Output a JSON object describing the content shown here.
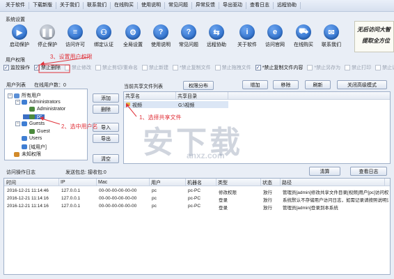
{
  "menubar": {
    "items": [
      "关于软件",
      "下载新版",
      "关于我们",
      "联系我们",
      "在线购买",
      "使用说明",
      "常见问题",
      "异常反馈",
      "导出驱动",
      "查看日志",
      "远程协助"
    ]
  },
  "system_settings": {
    "label": "系统设置"
  },
  "toolbar": {
    "buttons": [
      {
        "label": "启动保护",
        "icon": "play-icon",
        "color": "#1a5fc2"
      },
      {
        "label": "停止保护",
        "icon": "pause-icon",
        "color": "#9aa3b1"
      },
      {
        "label": "访问许可",
        "icon": "user-list-icon",
        "color": "#1a5fc2"
      },
      {
        "label": "绑定认证",
        "icon": "link-icon",
        "color": "#1a5fc2"
      },
      {
        "label": "全局设置",
        "icon": "gear-icon",
        "color": "#1a5fc2"
      },
      {
        "label": "使用说明",
        "icon": "help-icon",
        "color": "#1a5fc2"
      },
      {
        "label": "常见问题",
        "icon": "help-icon",
        "color": "#1a5fc2"
      },
      {
        "label": "远程协助",
        "icon": "remote-icon",
        "color": "#1a5fc2"
      },
      {
        "label": "关于软件",
        "icon": "info-icon",
        "color": "#1a5fc2"
      },
      {
        "label": "访问官网",
        "icon": "browser-icon",
        "color": "#1a5fc2"
      },
      {
        "label": "在线购买",
        "icon": "cart-icon",
        "color": "#1a5fc2"
      },
      {
        "label": "联系我们",
        "icon": "contact-icon",
        "color": "#1a5fc2"
      }
    ]
  },
  "logo": {
    "line1": "无后访问大智",
    "line2": "提取全方位"
  },
  "user_permissions": {
    "label": "用户权限",
    "items": [
      {
        "label": "监控操作",
        "checked": true,
        "enabled": true
      },
      {
        "label": "禁止删除",
        "checked": true,
        "enabled": true
      },
      {
        "label": "禁止修改",
        "checked": false,
        "enabled": false
      },
      {
        "label": "禁止剪切/重命名",
        "checked": false,
        "enabled": false
      },
      {
        "label": "禁止新建",
        "checked": false,
        "enabled": false
      },
      {
        "label": "*禁止复制文件",
        "checked": false,
        "enabled": false
      },
      {
        "label": "禁止拖拽文件",
        "checked": false,
        "enabled": false
      },
      {
        "label": "*禁止复制文件内容",
        "checked": true,
        "enabled": true
      },
      {
        "label": "*禁止另存为",
        "checked": false,
        "enabled": false
      },
      {
        "label": "禁止打印",
        "checked": false,
        "enabled": false
      },
      {
        "label": "禁止读取",
        "checked": false,
        "enabled": false
      }
    ]
  },
  "user_list": {
    "label": "用户列表",
    "online_label": "在线用户数：0",
    "tree": [
      {
        "label": "所有用户",
        "level": 0,
        "toggle": "−"
      },
      {
        "label": "Administrators",
        "level": 1,
        "toggle": "−"
      },
      {
        "label": "Administrator",
        "level": 2,
        "toggle": ""
      },
      {
        "label": "pc",
        "level": 2,
        "toggle": ""
      },
      {
        "label": "Guests",
        "level": 1,
        "toggle": "−"
      },
      {
        "label": "Guest",
        "level": 2,
        "toggle": ""
      },
      {
        "label": "Users",
        "level": 1,
        "toggle": ""
      },
      {
        "label": "[域用户]",
        "level": 1,
        "toggle": ""
      },
      {
        "label": "未知权限",
        "level": 0,
        "toggle": ""
      }
    ],
    "buttons": [
      "添加",
      "删除",
      "导入",
      "导出",
      "清空"
    ]
  },
  "share_list": {
    "label": "当前共享文件列表",
    "distribute_button": "权限分布",
    "buttons": [
      "增加",
      "移除",
      "刷新",
      "关闭高级模式"
    ],
    "columns": [
      "共享名",
      "共享目录"
    ],
    "rows": [
      {
        "name": "视频",
        "path": "G:\\视频"
      }
    ]
  },
  "access_log": {
    "label": "访问操作日志",
    "sent_label": "发送包总: 接收包:0",
    "clear_button": "清算",
    "view_button": "查看日志",
    "columns": [
      "时间",
      "IP",
      "Mac",
      "用户",
      "机器名",
      "类型",
      "状态",
      "路径"
    ],
    "rows": [
      [
        "2016-12-21 11:14:46",
        "127.0.0.1",
        "00-00-00-00-00-00",
        "pc",
        "pc-PC",
        "修改权限",
        "放行",
        "管理员[admin]修改共享文件目录[视频]用户[pc]访问权"
      ],
      [
        "2016-12-21 11:14:16",
        "127.0.0.1",
        "00-00-00-00-00-00",
        "pc",
        "pc-PC",
        "登录",
        "放行",
        "系统默认不存储用户访问日志，如需记录请按照说明设"
      ],
      [
        "2016-12-21 11:14:16",
        "127.0.0.1",
        "00-00-00-00-00-00",
        "pc",
        "pc-PC",
        "登录",
        "放行",
        "管理员[admin]登录到本系统"
      ]
    ]
  },
  "annotations": {
    "step1": "1、选择共享文件",
    "step2": "2、选中用户名",
    "step3": "3、设置用户权限",
    "color": "#e0323a"
  },
  "watermark": {
    "main": "安下载",
    "sub": "anxz.com"
  }
}
